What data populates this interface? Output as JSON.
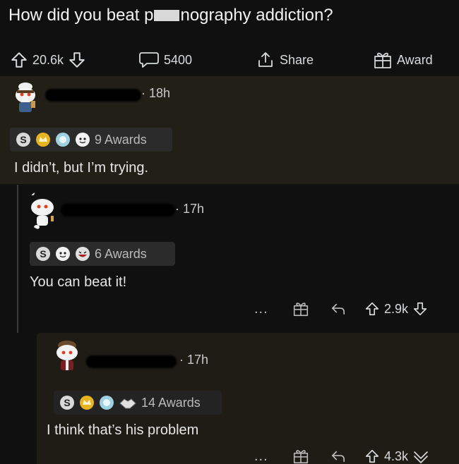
{
  "post": {
    "title_part1": "How did you beat p",
    "title_part2": "nography addiction?",
    "upvotes": "20.6k",
    "comments": "5400",
    "share": "Share",
    "award": "Award"
  },
  "comments": [
    {
      "time": "18h",
      "awards": "9 Awards",
      "text": "I didn’t, but I’m trying."
    },
    {
      "time": "17h",
      "awards": "6 Awards",
      "text": "You can beat it!",
      "votes": "2.9k",
      "more": "..."
    },
    {
      "time": "17h",
      "awards": "14 Awards",
      "text": "I think that’s his problem",
      "votes": "4.3k",
      "more": "..."
    }
  ],
  "colors": {
    "background": "#101010",
    "highlight": "#221f17",
    "text": "#d7dadc",
    "redaction": "#000000"
  }
}
